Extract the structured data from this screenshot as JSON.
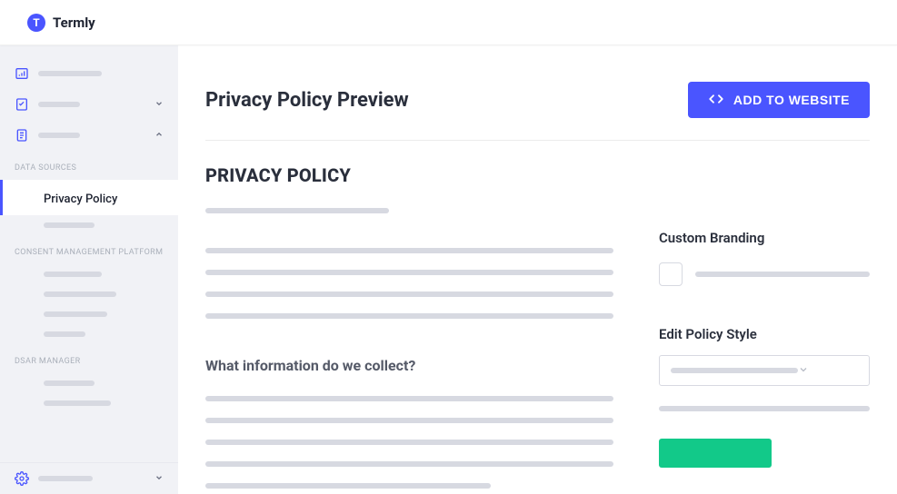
{
  "brand": {
    "name": "Termly",
    "badge_letter": "T"
  },
  "sidebar": {
    "groups": {
      "data_sources": {
        "label": "DATA SOURCES"
      },
      "active_item": {
        "label": "Privacy Policy"
      },
      "cmp": {
        "label": "CONSENT MANAGEMENT PLATFORM"
      },
      "dsar": {
        "label": "DSAR MANAGER"
      }
    }
  },
  "page": {
    "title": "Privacy Policy Preview",
    "add_button": "ADD TO WEBSITE"
  },
  "policy": {
    "heading": "PRIVACY POLICY",
    "section1_heading": "What information do we collect?"
  },
  "sidecol": {
    "branding_label": "Custom Branding",
    "style_label": "Edit Policy Style"
  }
}
